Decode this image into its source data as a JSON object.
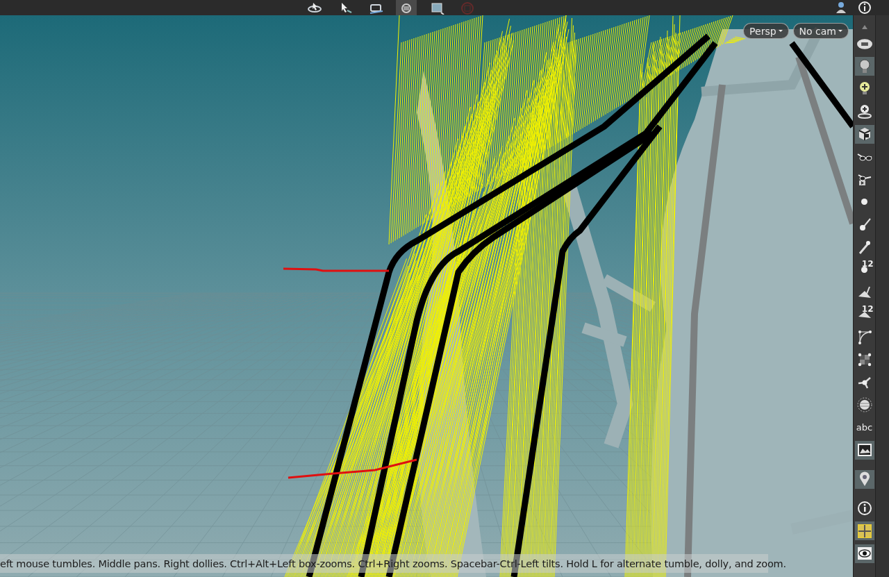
{
  "top_toolbar": {
    "tools": [
      {
        "selected": false
      },
      {
        "selected": false
      },
      {
        "selected": false
      },
      {
        "selected": true
      },
      {
        "selected": false
      },
      {
        "selected": false,
        "disabled": true
      }
    ]
  },
  "viewport": {
    "camera_menu": "Persp",
    "view_menu": "No cam",
    "status_text": "eft mouse tumbles. Middle pans. Right dollies. Ctrl+Alt+Left box-zooms. Ctrl+Right zooms. Spacebar-Ctrl-Left tilts. Hold L for alternate tumble, dolly, and zoom."
  },
  "side_toolbar": {
    "items": [
      {
        "selected": false
      },
      {
        "selected": true
      },
      {
        "selected": false
      },
      {
        "selected": false
      },
      {
        "selected": true
      },
      {
        "selected": false
      },
      {
        "selected": false
      },
      {
        "selected": false
      },
      {
        "selected": false
      },
      {
        "selected": false
      },
      {
        "selected": false,
        "label": "12"
      },
      {
        "selected": false
      },
      {
        "selected": false,
        "label": "12"
      },
      {
        "selected": false
      },
      {
        "selected": false
      },
      {
        "selected": false
      },
      {
        "selected": false
      },
      {
        "selected": false,
        "label": "abc"
      },
      {
        "selected": true
      },
      {
        "selected": true
      },
      {
        "selected": false
      },
      {
        "selected": true
      },
      {
        "selected": true
      }
    ]
  }
}
